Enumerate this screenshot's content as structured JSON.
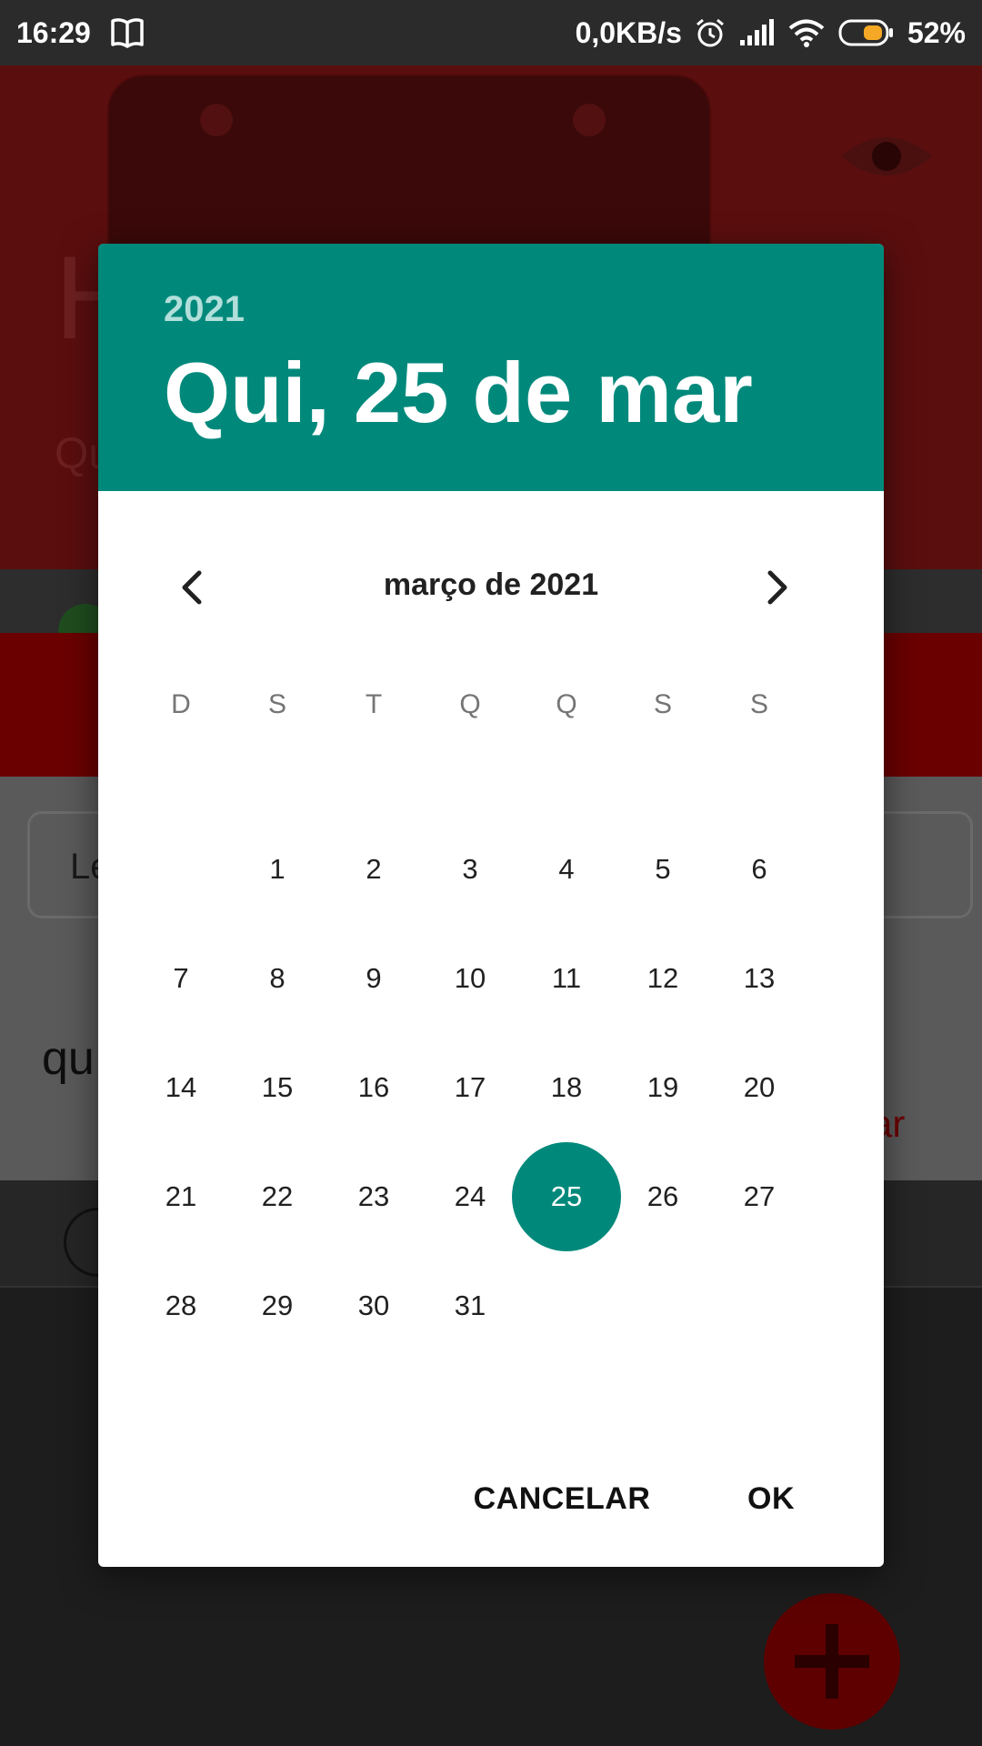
{
  "status_bar": {
    "time": "16:29",
    "net_speed": "0,0KB/s",
    "battery": "52%",
    "icons": [
      "book-icon",
      "alarm-icon",
      "signal-icon",
      "wifi-icon",
      "battery-icon"
    ]
  },
  "background_app": {
    "title_fragment": "H",
    "subtitle_fragment": "Qu",
    "input_fragment": "Le",
    "text_fragment": "qu",
    "link_fragment": "ar"
  },
  "date_picker": {
    "header_year": "2021",
    "header_date": "Qui, 25 de mar",
    "month_label": "março de 2021",
    "weekdays": [
      "D",
      "S",
      "T",
      "Q",
      "Q",
      "S",
      "S"
    ],
    "first_weekday_index": 1,
    "days_in_month": 31,
    "days": [
      "1",
      "2",
      "3",
      "4",
      "5",
      "6",
      "7",
      "8",
      "9",
      "10",
      "11",
      "12",
      "13",
      "14",
      "15",
      "16",
      "17",
      "18",
      "19",
      "20",
      "21",
      "22",
      "23",
      "24",
      "25",
      "26",
      "27",
      "28",
      "29",
      "30",
      "31"
    ],
    "selected_day": 25,
    "cancel_label": "CANCELAR",
    "ok_label": "OK",
    "colors": {
      "accent": "#00897b",
      "header_year": "#b2dfdb"
    }
  }
}
